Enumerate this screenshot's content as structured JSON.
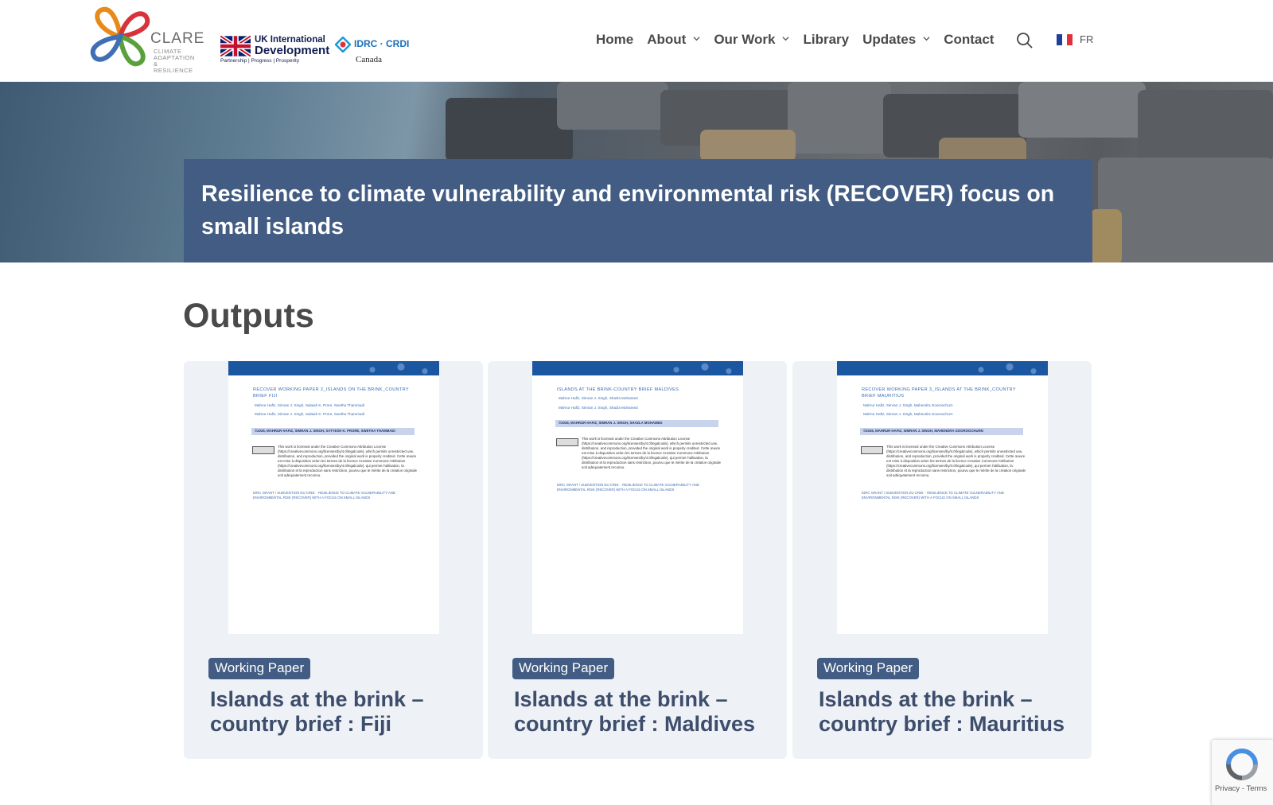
{
  "header": {
    "clare_logo": {
      "name": "CLARE",
      "tagline": [
        "CLIMATE",
        "ADAPTATION",
        "& RESILIENCE"
      ]
    },
    "uk_id_logo": {
      "line1": "UK International",
      "line2": "Development",
      "line3": "Partnership   |   Progress   |   Prosperity"
    },
    "idrc_logo": {
      "text": "IDRC · CRDI",
      "country": "Canada"
    },
    "nav": [
      {
        "label": "Home",
        "has_dropdown": false
      },
      {
        "label": "About",
        "has_dropdown": true
      },
      {
        "label": "Our Work",
        "has_dropdown": true
      },
      {
        "label": "Library",
        "has_dropdown": false
      },
      {
        "label": "Updates",
        "has_dropdown": true
      },
      {
        "label": "Contact",
        "has_dropdown": false
      }
    ],
    "search_icon": "search-icon",
    "language": {
      "label": "FR",
      "flag_colors": [
        "#1f3f9a",
        "#ffffff",
        "#e2303a"
      ]
    }
  },
  "hero": {
    "title": "Resilience to climate vulnerability and environmental risk (RECOVER) focus on small islands",
    "box_color": "#425c83"
  },
  "outputs": {
    "heading": "Outputs",
    "cards": [
      {
        "thumb_title": "RECOVER WORKING PAPER 2_ISLANDS ON THE BRINK_COUNTRY BRIEF FIJI",
        "thumb_authors": [
          "Mahrur Hafiz, Simran J. Singh, Salaiah K. Prore, Swetha Thammadi",
          "Mahrur Hafiz, Simran J. Singh, Salaiah K. Prore, Swetha Thammadi"
        ],
        "thumb_copyright": "©2026, MAHRUR HAFIZ, SIMRAN J. SINGH, SATYESH K. PRORE, SWETHA THAMMADI",
        "thumb_license": "This work is licensed under the Creative Commons Attribution License (https://creativecommons.org/licenses/by/4.0/legalcode), which permits unrestricted use, distribution, and reproduction, provided the original work is properly credited. Cette œuvre est mise à disposition selon les termes de la licence Creative Commons Attribution (https://creativecommons.org/licenses/by/4.0/legalcode), qui permet l'utilisation, la distribution et la reproduction sans restriction, pourvu que le mérite de la création originale soit adéquatement reconnu.",
        "thumb_footer": "IDRC GRANT / SUBVENTION DU CRDI: - RESILIENCE TO CLIMATE VULNERABILITY AND ENVIRONMENTAL RISK (RECOVER) WITH A FOCUS ON SMALL ISLANDS",
        "badge": "Working Paper",
        "title": "Islands at the brink – country brief : Fiji"
      },
      {
        "thumb_title": "ISLANDS AT THE BRINK-COUNTRY BRIEF MALDIVES",
        "thumb_authors": [
          "Mahrur Hafiz, Simran J. Singh, Shazla Mohamed",
          "Mahrur Hafiz, Simran J. Singh, Shazla Mohamed"
        ],
        "thumb_copyright": "©2026, MAHRUR HAFIZ, SIMRAN J. SINGH, SHAZLA MOHAMED",
        "thumb_license": "This work is licensed under the Creative Commons Attribution License (https://creativecommons.org/licenses/by/4.0/legalcode), which permits unrestricted use, distribution, and reproduction, provided the original work is properly credited. Cette œuvre est mise à disposition selon les termes de la licence Creative Commons Attribution (https://creativecommons.org/licenses/by/4.0/legalcode), qui permet l'utilisation, la distribution et la reproduction sans restriction, pourvu que le mérite de la création originale soit adéquatement reconnu.",
        "thumb_footer": "IDRC GRANT / SUBVENTION DU CRDI: - RESILIENCE TO CLIMATE VULNERABILITY AND ENVIRONMENTAL RISK (RECOVER) WITH A FOCUS ON SMALL ISLANDS",
        "badge": "Working Paper",
        "title": "Islands at the brink – country brief : Maldives"
      },
      {
        "thumb_title": "RECOVER WORKING PAPER 3_ISLANDS AT THE BRINK_COUNTRY BRIEF MAURITIUS",
        "thumb_authors": [
          "Mahrur Hafiz, Simran J. Singh, Mahendra Gooroochurn",
          "Mahrur Hafiz, Simran J. Singh, Mahendra Gooroochurn"
        ],
        "thumb_copyright": "©2026, MAHRUR HAFIZ, SIMRAN J. SINGH, MAHENDRA GOOROOCHURN",
        "thumb_license": "This work is licensed under the Creative Commons Attribution License (https://creativecommons.org/licenses/by/4.0/legalcode), which permits unrestricted use, distribution, and reproduction, provided the original work is properly credited. Cette œuvre est mise à disposition selon les termes de la licence Creative Commons Attribution (https://creativecommons.org/licenses/by/4.0/legalcode), qui permet l'utilisation, la distribution et la reproduction sans restriction, pourvu que le mérite de la création originale soit adéquatement reconnu.",
        "thumb_footer": "IDRC GRANT / SUBVENTION DU CRDI: - RESILIENCE TO CLIMATE VULNERABILITY AND ENVIRONMENTAL RISK (RECOVER) WITH A FOCUS ON SMALL ISLANDS",
        "badge": "Working Paper",
        "title": "Islands at the brink – country brief : Mauritius"
      }
    ]
  },
  "recaptcha": {
    "privacy": "Privacy",
    "separator": " - ",
    "terms": "Terms"
  }
}
